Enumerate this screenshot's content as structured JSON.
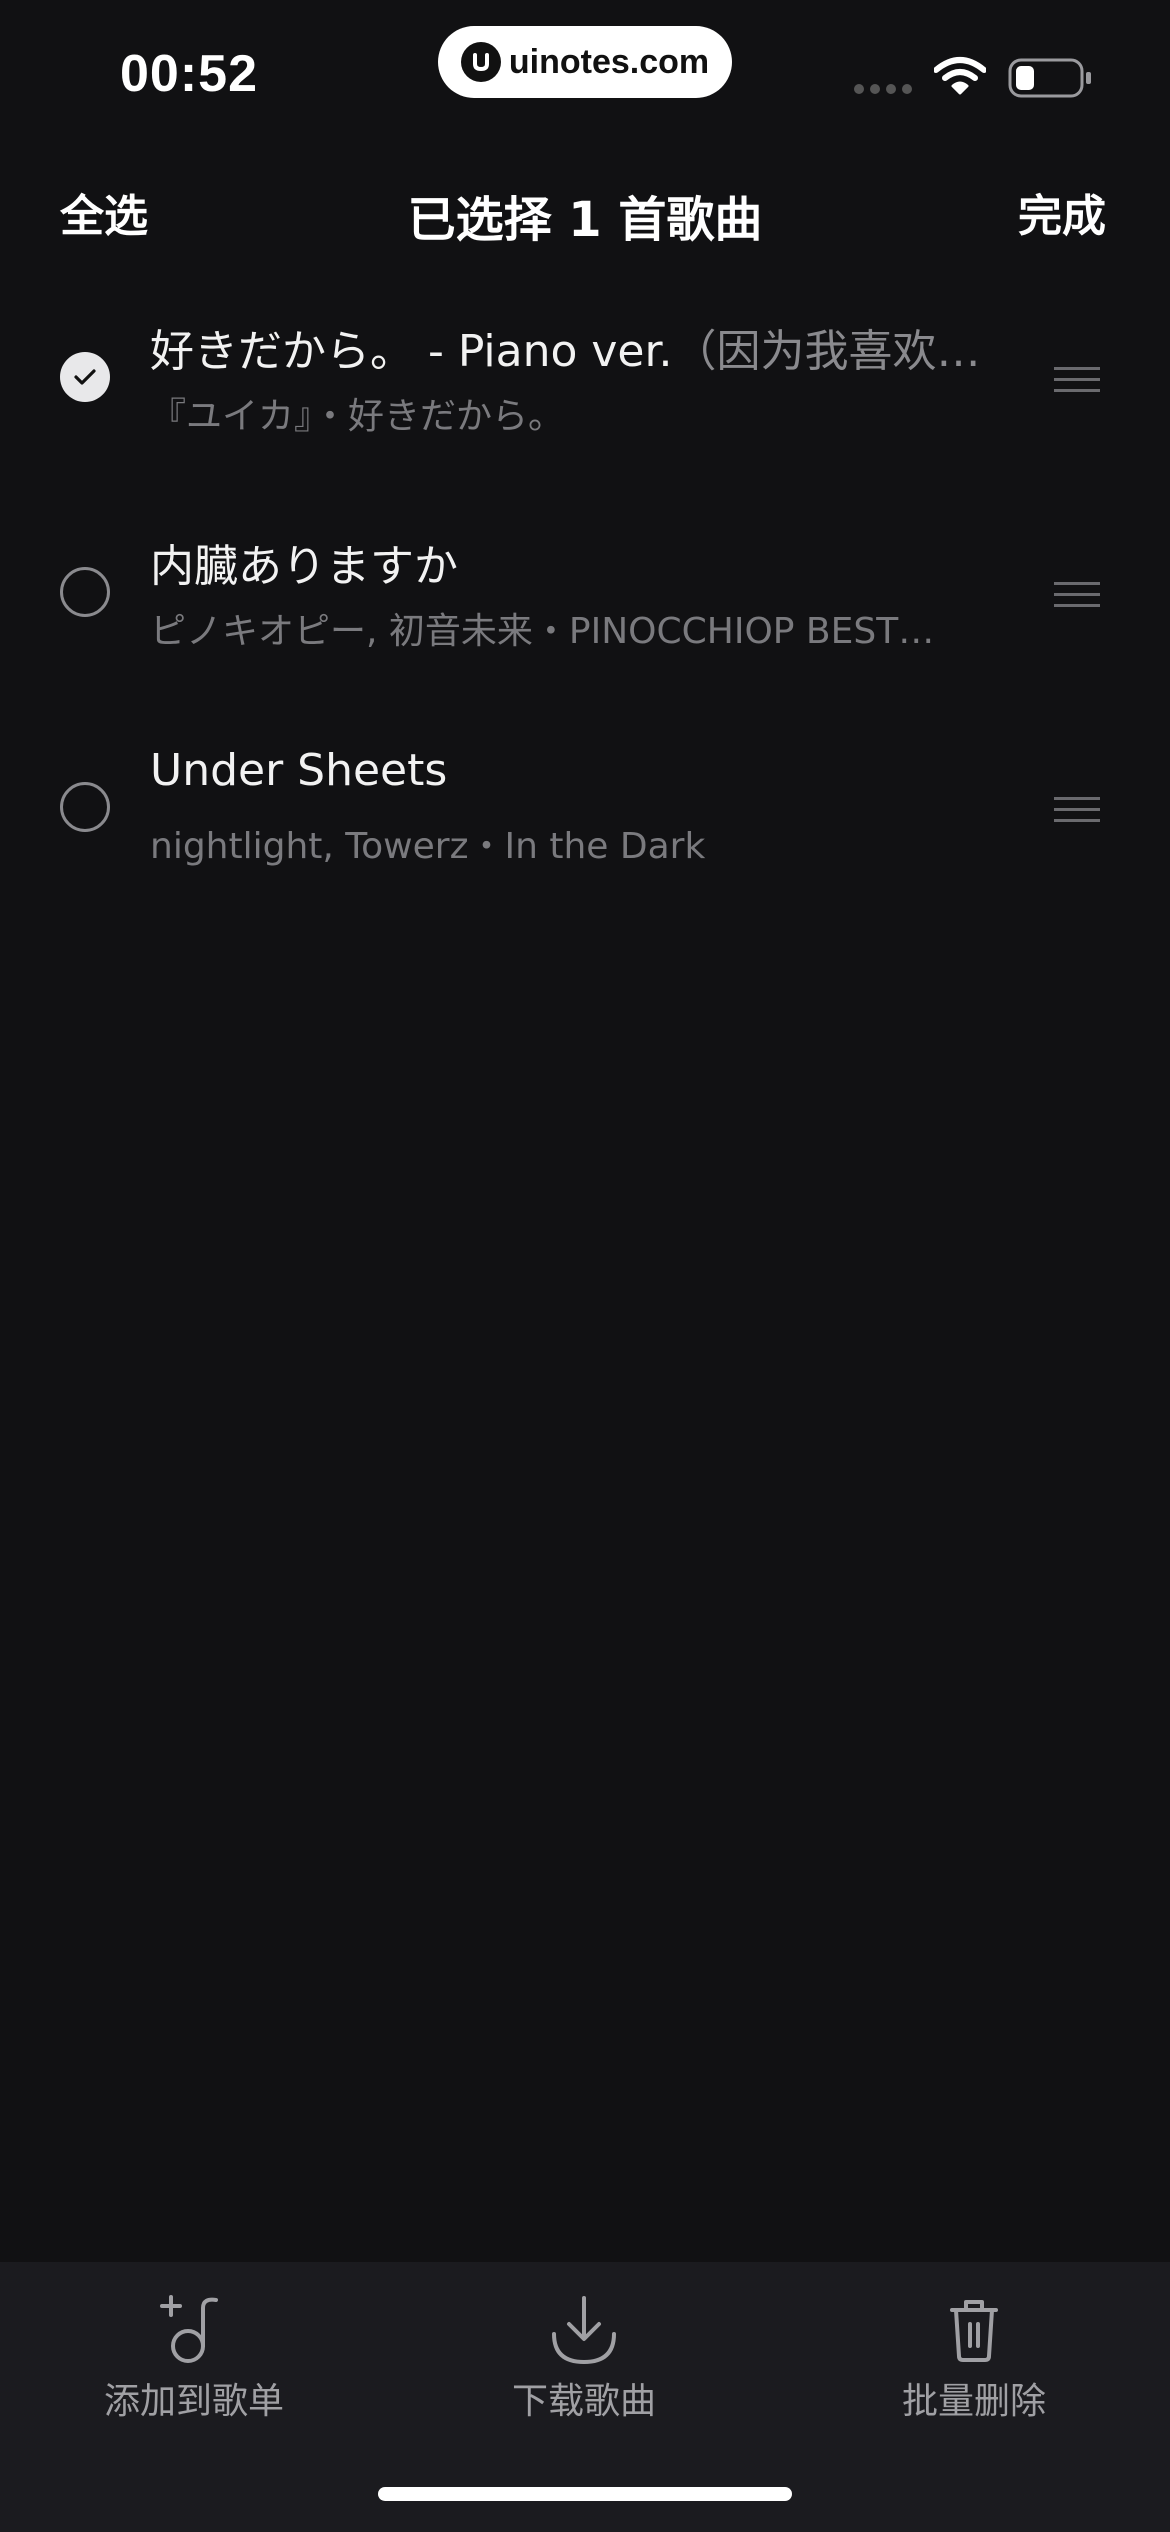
{
  "status_bar": {
    "time": "00:52",
    "watermark": "uinotes.com"
  },
  "nav": {
    "select_all": "全选",
    "title": "已选择 1 首歌曲",
    "done": "完成"
  },
  "songs": [
    {
      "title": "好きだから。 - Piano ver.",
      "title_extra": "（因为我喜欢…",
      "subtitle": "『ユイカ』・好きだから。",
      "selected": true
    },
    {
      "title": "内臓ありますか",
      "title_extra": "",
      "subtitle": "ピノキオピー, 初音未来・PINOCCHIOP BEST…",
      "selected": false
    },
    {
      "title": "Under Sheets",
      "title_extra": "",
      "subtitle": "nightlight, Towerz・In the Dark",
      "selected": false
    }
  ],
  "toolbar": {
    "add_to_playlist": "添加到歌单",
    "download": "下载歌曲",
    "batch_delete": "批量删除"
  },
  "icons": {
    "checkbox_checked": "check-icon",
    "drag": "drag-handle-icon",
    "add_playlist": "add-music-icon",
    "download": "download-icon",
    "delete": "trash-icon"
  }
}
